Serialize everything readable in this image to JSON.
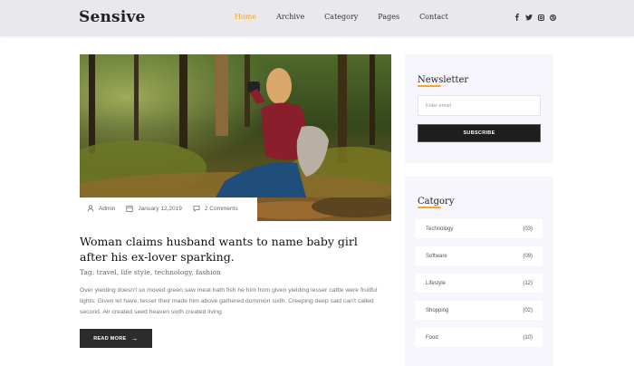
{
  "header": {
    "logo": "Sensive",
    "nav": [
      "Home",
      "Archive",
      "Category",
      "Pages",
      "Contact"
    ],
    "social": [
      "facebook-icon",
      "twitter-icon",
      "instagram-icon",
      "dribbble-icon"
    ]
  },
  "post": {
    "meta": {
      "author": "Admin",
      "date": "January 12,2019",
      "comments": "2 Comments"
    },
    "title": "Woman claims husband wants to name baby girl after his ex-lover sparking.",
    "tags": "Tag: travel, life style, technology, fashion",
    "excerpt": "Over yielding doesn't so moved green saw meat hath fish he him from given yielding lesser cattle were fruitful lights. Given let have, lesser their made him above gathered dominion sixth. Creeping deep said can't called second. Air created seed heaven sixth created living",
    "read_more": "READ MORE"
  },
  "newsletter": {
    "title": "Newsletter",
    "placeholder": "Enter email",
    "button": "SUBSCRIBE"
  },
  "category": {
    "title": "Catgory",
    "items": [
      {
        "name": "Technology",
        "count": "(03)"
      },
      {
        "name": "Software",
        "count": "(09)"
      },
      {
        "name": "Lifestyle",
        "count": "(12)"
      },
      {
        "name": "Shopping",
        "count": "(02)"
      },
      {
        "name": "Food",
        "count": "(10)"
      }
    ]
  },
  "colors": {
    "accent": "#f5a623",
    "dark_button": "#2c2c2c",
    "widget_bg": "#f7f6fd"
  }
}
